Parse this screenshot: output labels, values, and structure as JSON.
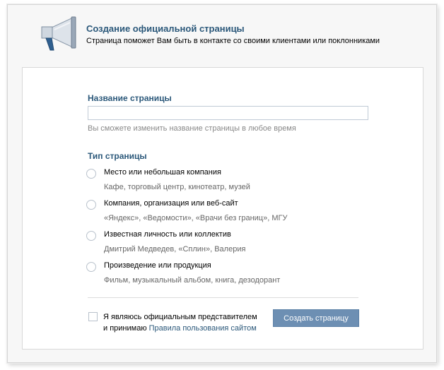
{
  "header": {
    "icon": "megaphone-icon",
    "title": "Создание официальной страницы",
    "subtitle": "Страница поможет Вам быть в контакте со своими клиентами или поклонниками"
  },
  "name_section": {
    "title": "Название страницы",
    "input_value": "",
    "hint": "Вы сможете изменить название страницы в любое время"
  },
  "type_section": {
    "title": "Тип страницы",
    "options": [
      {
        "label": "Место или небольшая компания",
        "description": "Кафе, торговый центр, кинотеатр, музей",
        "selected": false
      },
      {
        "label": "Компания, организация или веб-сайт",
        "description": "«Яндекс», «Ведомости», «Врачи без границ», МГУ",
        "selected": false
      },
      {
        "label": "Известная личность или коллектив",
        "description": "Дмитрий Медведев, «Сплин», Валерия",
        "selected": false
      },
      {
        "label": "Произведение или продукция",
        "description": "Фильм, музыкальный альбом, книга, дезодорант",
        "selected": false
      }
    ]
  },
  "agreement": {
    "checked": false,
    "text_line1": "Я являюсь официальным представителем",
    "text_line2_prefix": "и принимаю ",
    "link_text": "Правила пользования сайтом"
  },
  "create_button": {
    "label": "Создать страницу"
  },
  "colors": {
    "accent": "#2b587a",
    "button": "#6d8fb3"
  }
}
